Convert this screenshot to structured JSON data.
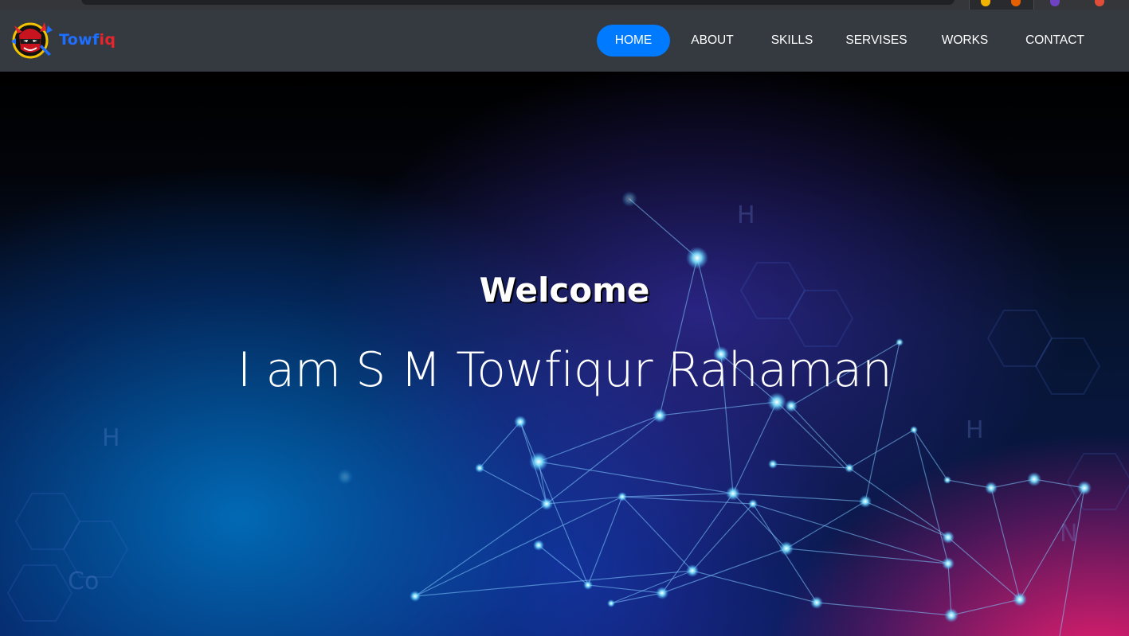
{
  "browser": {
    "extension_icons": [
      "chrome-icon",
      "firefox-icon",
      "extension-icon",
      "extension-icon"
    ]
  },
  "navbar": {
    "logo": {
      "text_main": "Towf",
      "text_accent": "iq",
      "icon": "ninja-mascot-icon"
    },
    "items": [
      {
        "label": "HOME",
        "active": true
      },
      {
        "label": "ABOUT",
        "active": false
      },
      {
        "label": "SKILLS",
        "active": false
      },
      {
        "label": "SERVISES",
        "active": false
      },
      {
        "label": "WORKS",
        "active": false
      },
      {
        "label": "CONTACT",
        "active": false
      }
    ]
  },
  "hero": {
    "title": "Welcome",
    "subtitle": "I am S M Towfiqur Rahaman",
    "background": "network-plexus-background"
  },
  "colors": {
    "navbar_bg": "#343a40",
    "active_pill": "#007bff",
    "text": "#ffffff",
    "logo_blue": "#1e6fff",
    "logo_red": "#e8242c"
  }
}
